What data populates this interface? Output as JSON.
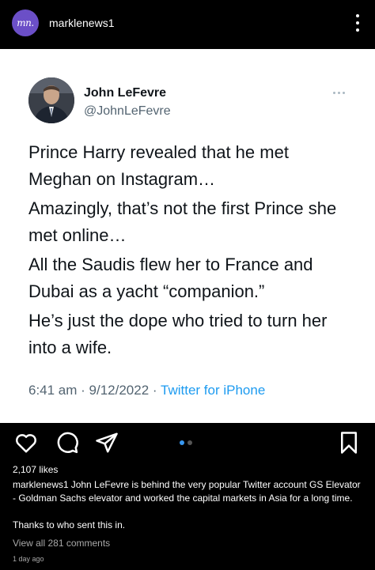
{
  "header": {
    "avatar_monogram": "mn.",
    "username": "marklenews1"
  },
  "tweet": {
    "name": "John LeFevre",
    "handle": "@JohnLeFevre",
    "paragraphs": [
      "Prince Harry revealed that he met Meghan on Instagram…",
      "Amazingly, that’s not the first Prince she met online…",
      "All the Saudis flew her to France and Dubai as a yacht “companion.”",
      "He’s just the dope who tried to turn her into a wife."
    ],
    "time": "6:41 am",
    "date": "9/12/2022",
    "source": "Twitter for iPhone"
  },
  "actions": {
    "icons": [
      "heart-icon",
      "comment-icon",
      "share-icon",
      "bookmark-icon"
    ],
    "carousel_index": 1,
    "carousel_count": 2,
    "accent_color": "#3897f0"
  },
  "post": {
    "likes": "2,107 likes",
    "caption_user": "marklenews1",
    "caption_text": "John LeFevre is behind the very popular Twitter account GS Elevator - Goldman Sachs elevator and worked the capital markets in Asia for a long time.",
    "thanks_line": "Thanks to who sent this in.",
    "view_comments": "View all 281 comments",
    "time_ago": "1 day ago"
  }
}
